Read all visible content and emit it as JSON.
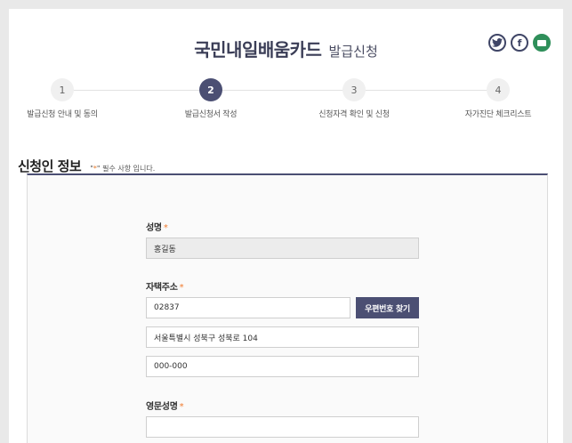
{
  "header": {
    "title": "국민내일배움카드",
    "subtitle": "발급신청",
    "share": [
      {
        "icon": "twitter-icon",
        "glyph": "t"
      },
      {
        "icon": "facebook-icon",
        "glyph": "f"
      },
      {
        "icon": "print-icon",
        "glyph": ""
      }
    ]
  },
  "steps": [
    {
      "number": "1",
      "label": "발급신청 안내 및 동의",
      "active": false
    },
    {
      "number": "2",
      "label": "발급신청서 작성",
      "active": true
    },
    {
      "number": "3",
      "label": "신청자격 확인 및 신청",
      "active": false
    },
    {
      "number": "4",
      "label": "자가진단 체크리스트",
      "active": false
    }
  ],
  "section": {
    "title": "신청인 정보",
    "required_note_prefix": "\"",
    "required_note_star": "*",
    "required_note_suffix": "\" 필수 사항 입니다."
  },
  "form": {
    "name": {
      "label": "성명",
      "star": "*",
      "value": "홍길동"
    },
    "address": {
      "label": "자택주소",
      "star": "*",
      "zipcode": "02837",
      "zip_button": "우편번호 찾기",
      "address1": "서울특별시 성북구 성북로 104",
      "address2": "000-000"
    },
    "english_name": {
      "label": "영문성명",
      "star": "*",
      "value": ""
    }
  },
  "colors": {
    "accent": "#4b4f73",
    "required_star": "#f07b2e",
    "print_icon": "#2f8f5a"
  }
}
